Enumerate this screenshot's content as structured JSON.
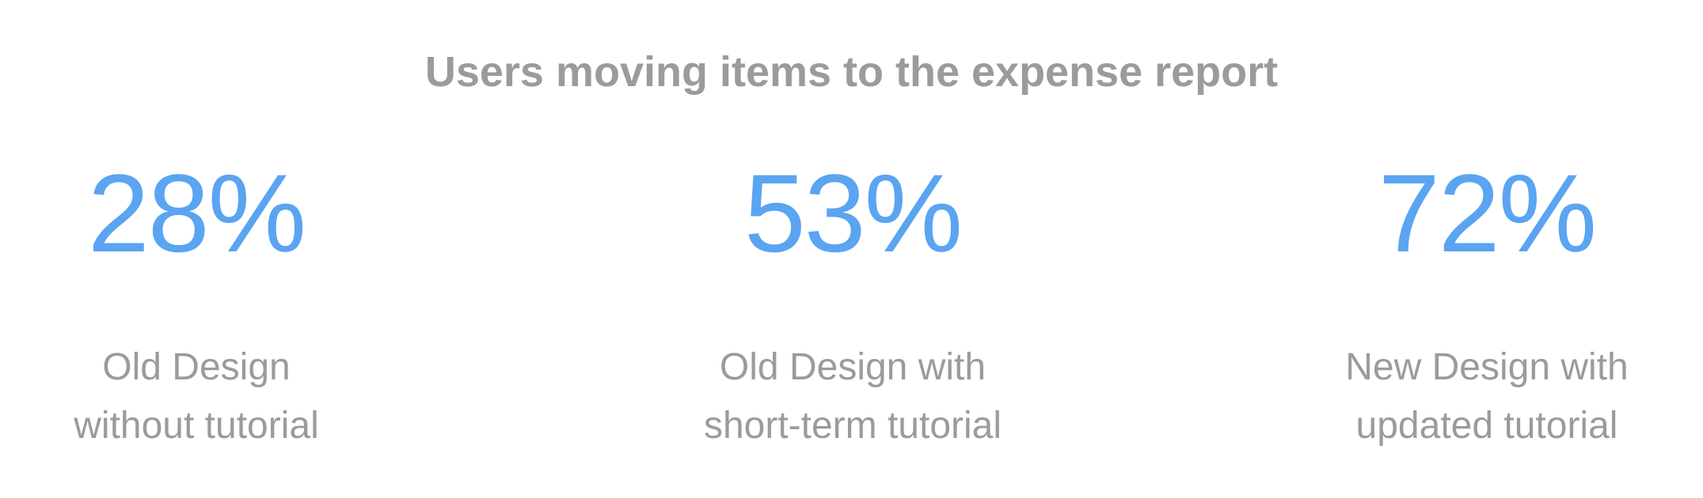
{
  "title": "Users moving items to the expense report",
  "accent_color": "#5aa4f1",
  "text_color": "#9b9b9b",
  "stats": [
    {
      "value": "28%",
      "label_line1": "Old Design",
      "label_line2": "without tutorial"
    },
    {
      "value": "53%",
      "label_line1": "Old Design with",
      "label_line2": "short-term tutorial"
    },
    {
      "value": "72%",
      "label_line1": "New Design with",
      "label_line2": "updated tutorial"
    }
  ]
}
